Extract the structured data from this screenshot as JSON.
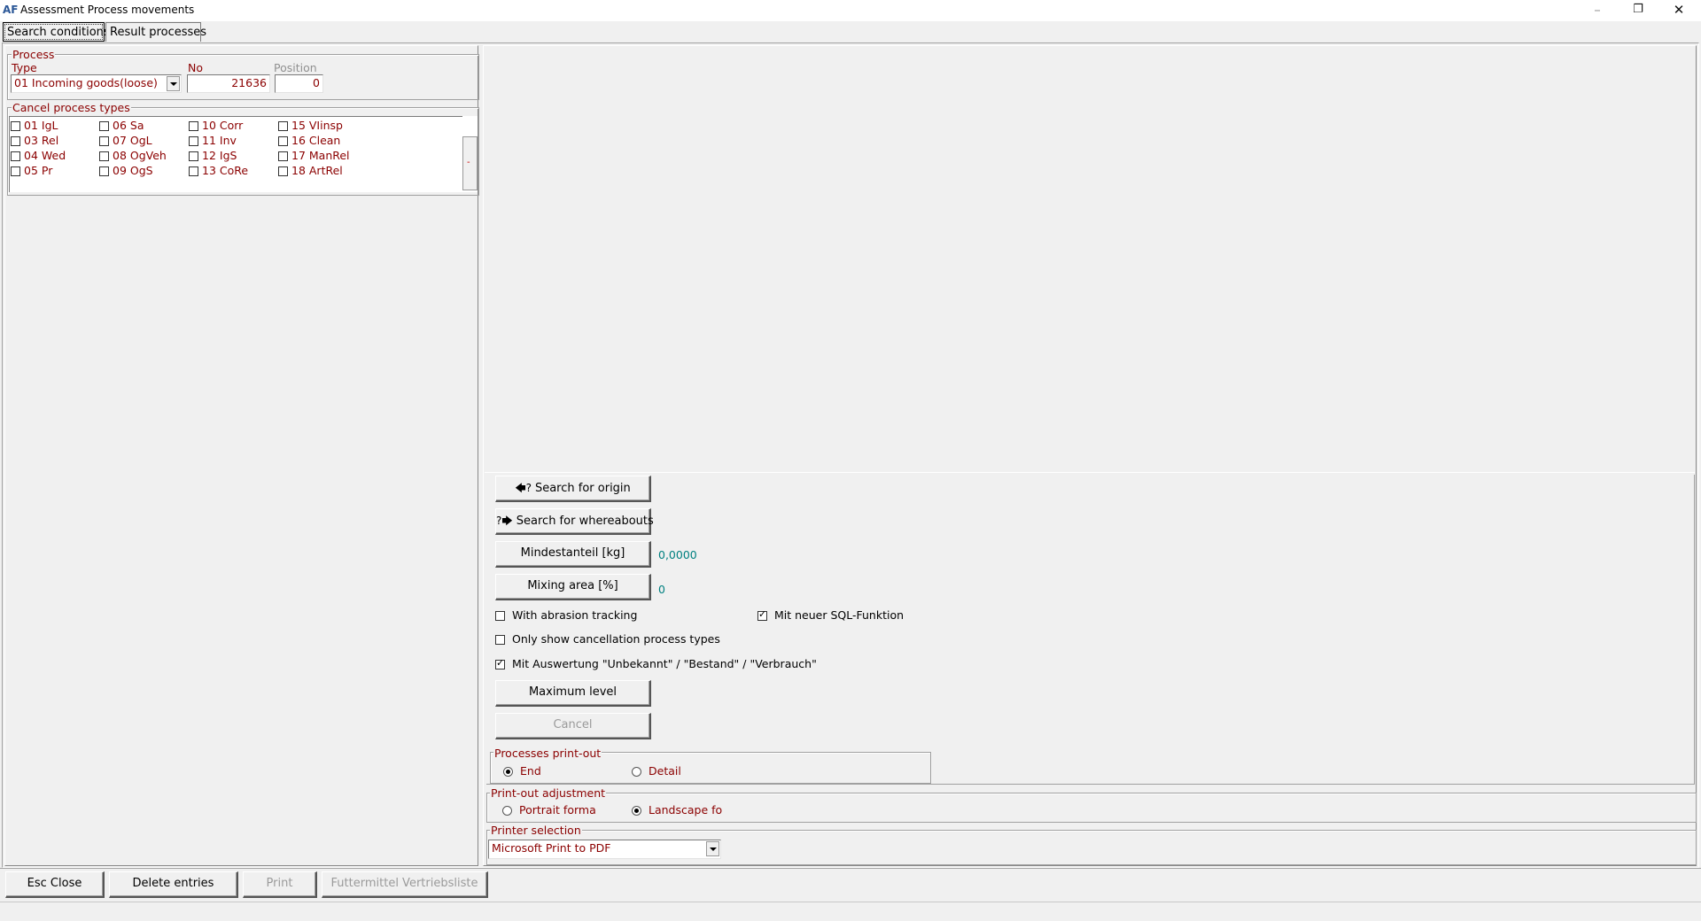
{
  "window": {
    "title": "Assessment Process movements",
    "app_icon": "AF",
    "minimize_icon": "–",
    "restore_icon": "❐",
    "close_icon": "✕"
  },
  "tabs": [
    {
      "label": "Search conditions",
      "active": true
    },
    {
      "label": "Result processes",
      "active": false
    }
  ],
  "process": {
    "group_title": "Process",
    "type_label": "Type",
    "type_value": "01 Incoming goods(loose)",
    "no_label": "No",
    "no_value": "21636",
    "position_label": "Position",
    "position_value": "0"
  },
  "cancel_types": {
    "group_title": "Cancel process types",
    "scroll_marker": "-",
    "items": [
      {
        "label": "01 IgL",
        "checked": false
      },
      {
        "label": "06 Sa",
        "checked": false
      },
      {
        "label": "10 Corr",
        "checked": false
      },
      {
        "label": "15 VIinsp",
        "checked": false
      },
      {
        "label": "03 Rel",
        "checked": false
      },
      {
        "label": "07 OgL",
        "checked": false
      },
      {
        "label": "11 Inv",
        "checked": false
      },
      {
        "label": "16 Clean",
        "checked": false
      },
      {
        "label": "04 Wed",
        "checked": false
      },
      {
        "label": "08 OgVeh",
        "checked": false
      },
      {
        "label": "12 IgS",
        "checked": false
      },
      {
        "label": "17 ManRel",
        "checked": false
      },
      {
        "label": "05 Pr",
        "checked": false
      },
      {
        "label": "09 OgS",
        "checked": false
      },
      {
        "label": "13 CoRe",
        "checked": false
      },
      {
        "label": "18 ArtRel",
        "checked": false
      }
    ]
  },
  "actions": {
    "search_origin": "Search for origin",
    "search_origin_icon": "🡄?",
    "search_whereabouts": "Search for whereabouts",
    "search_whereabouts_icon": "?🡆",
    "mindestanteil_label": "Mindestanteil [kg]",
    "mindestanteil_value": "0,0000",
    "mixing_label": "Mixing area [%]",
    "mixing_value": "0",
    "abrasion_label": "With abrasion tracking",
    "abrasion_checked": false,
    "sql_label": "Mit neuer SQL-Funktion",
    "sql_checked": true,
    "only_cancel_label": "Only show cancellation process types",
    "only_cancel_checked": false,
    "auswertung_label": "Mit Auswertung \"Unbekannt\" / \"Bestand\" / \"Verbrauch\"",
    "auswertung_checked": true,
    "max_level": "Maximum level",
    "cancel": "Cancel"
  },
  "print_out": {
    "group_title": "Processes print-out",
    "end_label": "End",
    "detail_label": "Detail",
    "selected": "End"
  },
  "adjustment": {
    "group_title": "Print-out adjustment",
    "portrait_label": "Portrait forma",
    "landscape_label": "Landscape fo",
    "selected": "Landscape"
  },
  "printer": {
    "group_title": "Printer selection",
    "value": "Microsoft Print to PDF"
  },
  "footer": {
    "close": "Esc Close",
    "delete": "Delete entries",
    "print": "Print",
    "futtermittel": "Futtermittel Vertriebsliste"
  }
}
